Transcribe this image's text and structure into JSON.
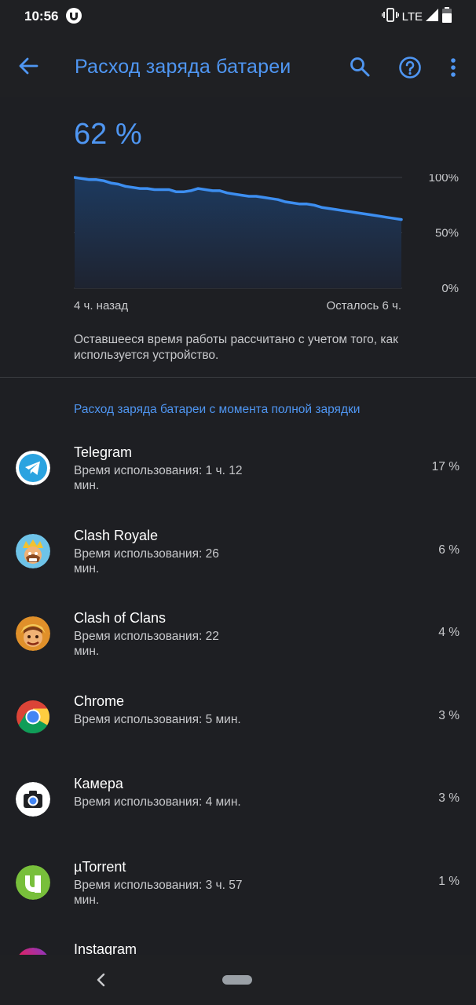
{
  "status_bar": {
    "time": "10:56",
    "app_icon": "utorrent-icon",
    "network": "LTE",
    "icons": [
      "vibrate-icon",
      "signal-icon",
      "battery-icon"
    ]
  },
  "app_bar": {
    "title": "Расход заряда батареи",
    "back_icon": "arrow-back-icon",
    "search_icon": "search-icon",
    "help_icon": "help-circle-icon",
    "more_icon": "more-vert-icon"
  },
  "battery": {
    "percent_text": "62 %",
    "time_ago_label": "4 ч. назад",
    "remaining_label": "Осталось 6 ч.",
    "note": "Оставшееся время работы рассчитано с учетом того, как используется устройство."
  },
  "chart_data": {
    "type": "area",
    "x_labels": [
      "4 ч. назад",
      "Осталось 6 ч."
    ],
    "y_ticks": [
      "100%",
      "50%",
      "0%"
    ],
    "ylim": [
      0,
      100
    ],
    "series": [
      {
        "values": [
          100,
          99,
          98,
          98,
          97,
          95,
          94,
          92,
          91,
          90,
          90,
          89,
          89,
          89,
          87,
          87,
          88,
          90,
          89,
          88,
          88,
          86,
          85,
          84,
          83,
          83,
          82,
          81,
          80,
          78,
          77,
          76,
          76,
          75,
          73,
          72,
          71,
          70,
          69,
          68,
          67,
          66,
          65,
          64,
          63,
          62
        ]
      }
    ],
    "colors": {
      "line": "#3d8ef0",
      "fill_top": "#1d3a5f",
      "fill_bottom": "#1e2330"
    },
    "grid": true
  },
  "section": {
    "title": "Расход заряда батареи с момента полной зарядки"
  },
  "apps": [
    {
      "name": "Telegram",
      "usage": "Время использования: 1 ч. 12 мин.",
      "percent": "17 %",
      "icon": "telegram-icon"
    },
    {
      "name": "Clash Royale",
      "usage": "Время использования: 26 мин.",
      "percent": "6 %",
      "icon": "clash-royale-icon"
    },
    {
      "name": "Clash of Clans",
      "usage": "Время использования: 22 мин.",
      "percent": "4 %",
      "icon": "clash-of-clans-icon"
    },
    {
      "name": "Chrome",
      "usage": "Время использования: 5 мин.",
      "percent": "3 %",
      "icon": "chrome-icon"
    },
    {
      "name": "Камера",
      "usage": "Время использования: 4 мин.",
      "percent": "3 %",
      "icon": "camera-icon"
    },
    {
      "name": "µTorrent",
      "usage": "Время использования: 3 ч. 57 мин.",
      "percent": "1 %",
      "icon": "utorrent-icon"
    },
    {
      "name": "Instagram",
      "usage": "",
      "percent": "",
      "icon": "instagram-icon"
    }
  ],
  "nav_bar": {
    "back_icon": "nav-back-icon",
    "home_icon": "nav-home-pill"
  }
}
